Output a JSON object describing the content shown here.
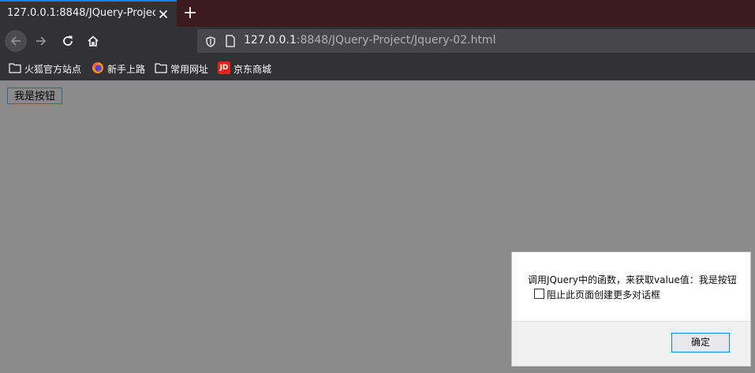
{
  "tab": {
    "title": "127.0.0.1:8848/JQuery-Project/Jq"
  },
  "url": {
    "host": "127.0.0.1",
    "rest": ":8848/JQuery-Project/Jquery-02.html"
  },
  "bookmarks": [
    {
      "label": "火狐官方站点",
      "icon": "folder-icon"
    },
    {
      "label": "新手上路",
      "icon": "firefox-icon"
    },
    {
      "label": "常用网址",
      "icon": "folder-icon"
    },
    {
      "label": "京东商城",
      "icon": "jd-icon",
      "icon_text": "JD"
    }
  ],
  "page": {
    "button_label": "我是按钮"
  },
  "dialog": {
    "message": "调用JQuery中的函数，来获取value值：我是按钮",
    "checkbox_label": "阻止此页面创建更多对话框",
    "checkbox_checked": false,
    "ok_label": "确定"
  },
  "colors": {
    "accent": "#0a84ff",
    "toolbar": "#323234",
    "tabstrip": "#3d1a1e",
    "page_bg": "#8a8a8a"
  }
}
